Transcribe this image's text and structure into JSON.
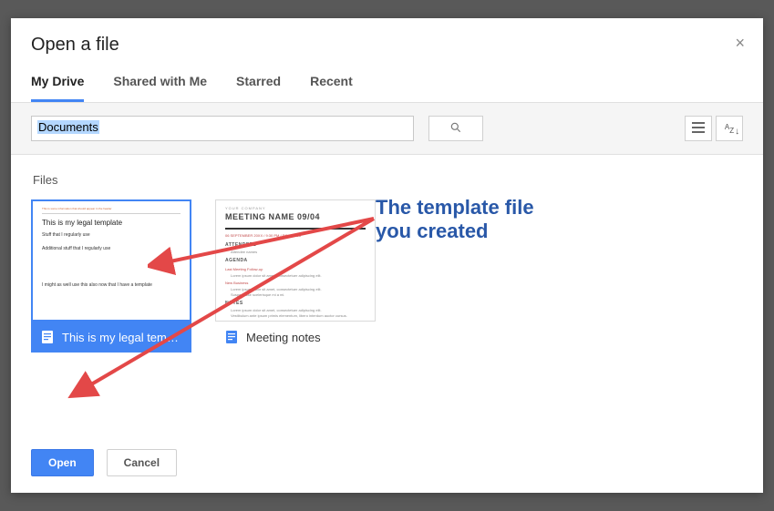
{
  "dialog": {
    "title": "Open a file",
    "close_label": "×"
  },
  "tabs": [
    {
      "label": "My Drive",
      "active": true
    },
    {
      "label": "Shared with Me",
      "active": false
    },
    {
      "label": "Starred",
      "active": false
    },
    {
      "label": "Recent",
      "active": false
    }
  ],
  "search": {
    "value": "Documents"
  },
  "section_label": "Files",
  "files": [
    {
      "name": "This is my legal temp…",
      "selected": true,
      "thumb": {
        "kind": "legal",
        "header": "This is some information that should appear in the header",
        "title": "This is my legal template",
        "lines": [
          "Stuff that I regularly use",
          "Additional stuff that I regularly use"
        ],
        "footer": "I might as well use this also now that I have a template"
      }
    },
    {
      "name": "Meeting notes",
      "selected": false,
      "thumb": {
        "kind": "meeting",
        "company": "YOUR COMPANY",
        "title": "MEETING NAME 09/04",
        "meta": "06 SEPTEMBER 20XX / 9:30 PM / ROOM 123",
        "attendees_head": "ATTENDEES",
        "attendees_body": "Attendee names",
        "agenda_head": "AGENDA",
        "agenda_sub": "Last Meeting Follow-up",
        "agenda_body": "Lorem ipsum dolor sit amet, consectetuer adipiscing elit.",
        "new_head": "New Business",
        "new_body1": "Lorem ipsum dolor sit amet, consectetuer adipiscing elit.",
        "new_body2": "Suspendisse scelerisque mi a mi.",
        "notes_head": "NOTES",
        "notes_body1": "Lorem ipsum dolor sit amet, consectetuer adipiscing elit.",
        "notes_body2": "Vestibulum ante ipsum primis elementum, libero interdum auctor cursus."
      }
    }
  ],
  "buttons": {
    "open": "Open",
    "cancel": "Cancel"
  },
  "annotation": {
    "line1": "The template file",
    "line2": "you created"
  },
  "colors": {
    "accent": "#4285f4",
    "annotation": "#2958a8",
    "arrow": "#e34848"
  }
}
